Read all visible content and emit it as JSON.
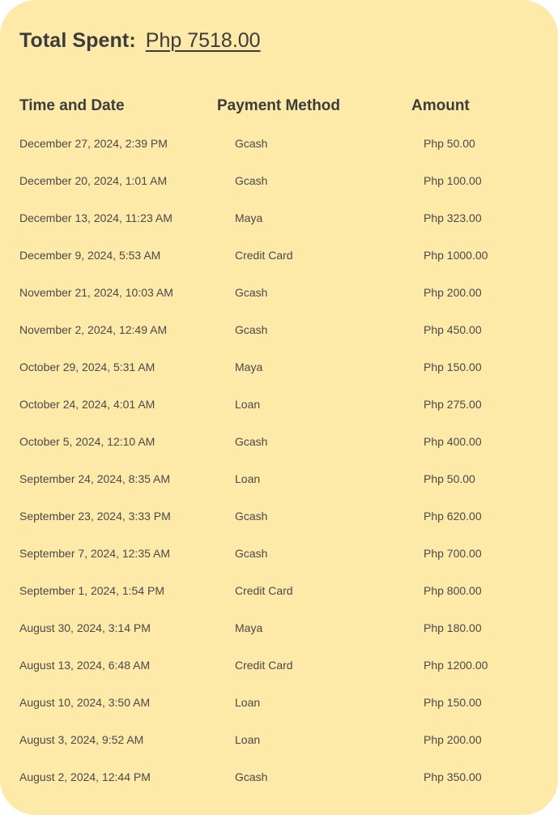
{
  "summary": {
    "label": "Total Spent:",
    "value": "Php 7518.00"
  },
  "table": {
    "headers": {
      "date": "Time and Date",
      "method": "Payment Method",
      "amount": "Amount"
    },
    "rows": [
      {
        "date": "December 27, 2024, 2:39 PM",
        "method": "Gcash",
        "amount": "Php 50.00"
      },
      {
        "date": "December 20, 2024, 1:01 AM",
        "method": "Gcash",
        "amount": "Php 100.00"
      },
      {
        "date": "December 13, 2024, 11:23 AM",
        "method": "Maya",
        "amount": "Php 323.00"
      },
      {
        "date": "December 9, 2024, 5:53 AM",
        "method": "Credit Card",
        "amount": "Php 1000.00"
      },
      {
        "date": "November 21, 2024, 10:03 AM",
        "method": "Gcash",
        "amount": "Php 200.00"
      },
      {
        "date": "November 2, 2024, 12:49 AM",
        "method": "Gcash",
        "amount": "Php 450.00"
      },
      {
        "date": "October 29, 2024, 5:31 AM",
        "method": "Maya",
        "amount": "Php 150.00"
      },
      {
        "date": "October 24, 2024, 4:01 AM",
        "method": "Loan",
        "amount": "Php 275.00"
      },
      {
        "date": "October 5, 2024, 12:10 AM",
        "method": "Gcash",
        "amount": "Php 400.00"
      },
      {
        "date": "September 24, 2024, 8:35 AM",
        "method": "Loan",
        "amount": "Php 50.00"
      },
      {
        "date": "September 23, 2024, 3:33 PM",
        "method": "Gcash",
        "amount": "Php 620.00"
      },
      {
        "date": "September 7, 2024, 12:35 AM",
        "method": "Gcash",
        "amount": "Php 700.00"
      },
      {
        "date": "September 1, 2024, 1:54 PM",
        "method": "Credit Card",
        "amount": "Php 800.00"
      },
      {
        "date": "August 30, 2024, 3:14 PM",
        "method": "Maya",
        "amount": "Php 180.00"
      },
      {
        "date": "August 13, 2024, 6:48 AM",
        "method": "Credit Card",
        "amount": "Php 1200.00"
      },
      {
        "date": "August 10, 2024, 3:50 AM",
        "method": "Loan",
        "amount": "Php 150.00"
      },
      {
        "date": "August 3, 2024, 9:52 AM",
        "method": "Loan",
        "amount": "Php 200.00"
      },
      {
        "date": "August 2, 2024, 12:44 PM",
        "method": "Gcash",
        "amount": "Php 350.00"
      }
    ]
  },
  "colors": {
    "card_background": "#fde9a8",
    "text_primary": "#3c3c3c",
    "text_secondary": "#4a4a4a"
  }
}
